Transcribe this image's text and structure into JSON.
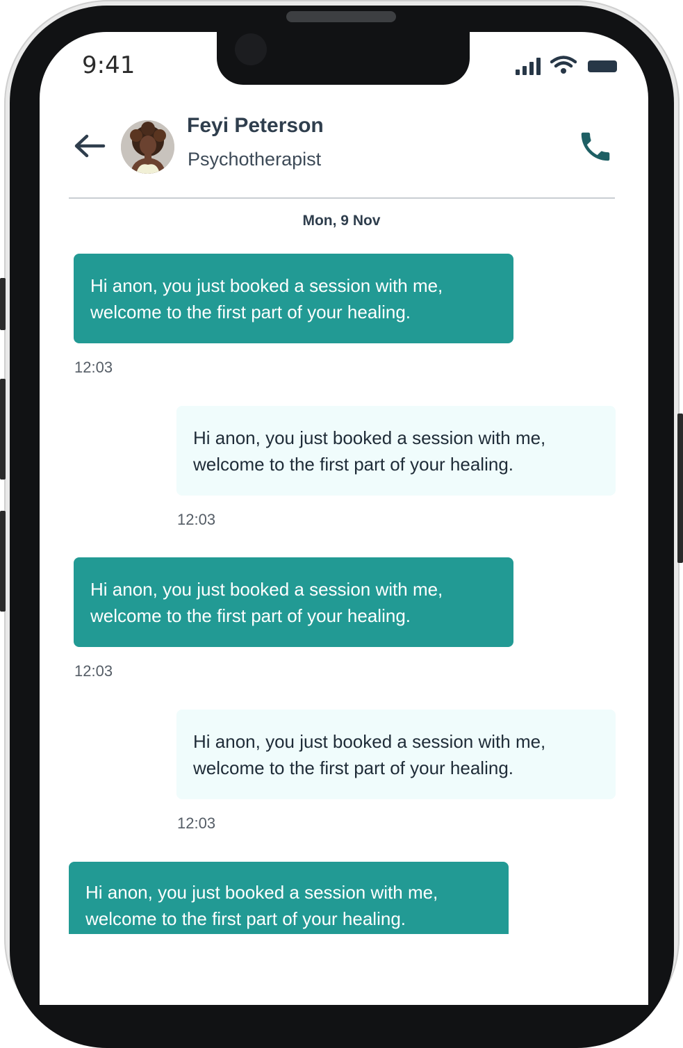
{
  "status_bar": {
    "time": "9:41"
  },
  "header": {
    "contact_name": "Feyi Peterson",
    "contact_role": "Psychotherapist"
  },
  "date_separator": "Mon, 9 Nov",
  "messages": [
    {
      "direction": "incoming",
      "text": "Hi anon, you just booked a session with me,\nwelcome to the first part of your healing.",
      "time": "12:03"
    },
    {
      "direction": "outgoing",
      "text": "Hi anon, you just booked a session with me,\nwelcome to the first part of your healing.",
      "time": "12:03"
    },
    {
      "direction": "incoming",
      "text": "Hi anon, you just booked a session with me,\nwelcome to the first part of your healing.",
      "time": "12:03"
    },
    {
      "direction": "outgoing",
      "text": "Hi anon, you just booked a session with me,\nwelcome to the first part of your healing.",
      "time": "12:03"
    },
    {
      "direction": "incoming",
      "text": "Hi anon, you just booked a session with me,\nwelcome to the first part of your healing.",
      "time": ""
    }
  ],
  "colors": {
    "accent": "#229a94",
    "outgoing_bubble": "#f0fcfc",
    "call_icon": "#1e5f64",
    "text_dark": "#2f3e4d"
  },
  "icons": [
    "back-arrow-icon",
    "phone-icon",
    "signal-icon",
    "wifi-icon",
    "battery-icon"
  ]
}
